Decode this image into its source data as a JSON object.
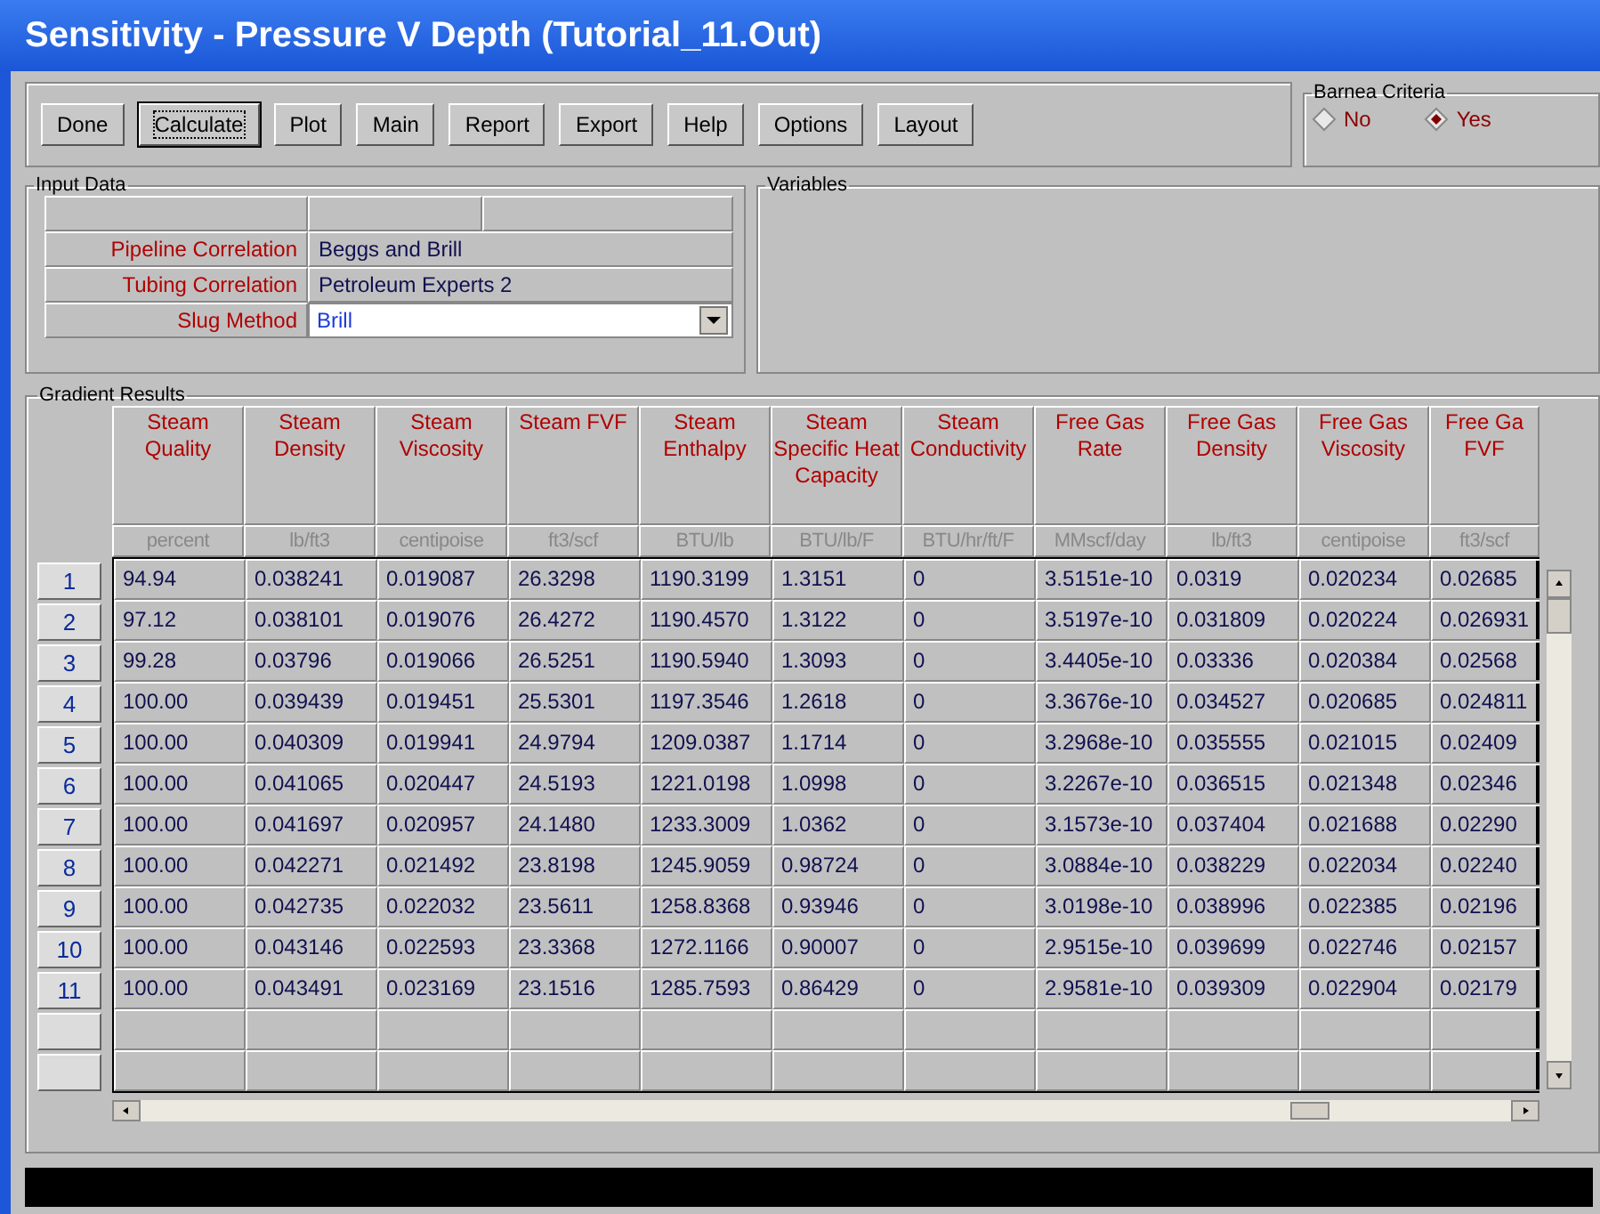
{
  "window": {
    "title": "Sensitivity - Pressure V Depth (Tutorial_11.Out)"
  },
  "toolbar": [
    {
      "label": "Done",
      "focused": false
    },
    {
      "label": "Calculate",
      "focused": true
    },
    {
      "label": "Plot",
      "focused": false
    },
    {
      "label": "Main",
      "focused": false
    },
    {
      "label": "Report",
      "focused": false
    },
    {
      "label": "Export",
      "focused": false
    },
    {
      "label": "Help",
      "focused": false
    },
    {
      "label": "Options",
      "focused": false
    },
    {
      "label": "Layout",
      "focused": false
    }
  ],
  "barnea_criteria": {
    "title": "Barnea Criteria",
    "options": [
      {
        "label": "No",
        "selected": false
      },
      {
        "label": "Yes",
        "selected": true
      }
    ]
  },
  "input_data": {
    "title": "Input Data",
    "rows": [
      {
        "label": "Pipeline Correlation",
        "value": "Beggs and Brill"
      },
      {
        "label": "Tubing Correlation",
        "value": "Petroleum Experts 2"
      }
    ],
    "slug_method": {
      "label": "Slug Method",
      "value": "Brill"
    }
  },
  "variables": {
    "title": "Variables"
  },
  "gradient_results": {
    "title": "Gradient Results",
    "columns": [
      {
        "name": "Steam Quality",
        "unit": "percent"
      },
      {
        "name": "Steam Density",
        "unit": "lb/ft3"
      },
      {
        "name": "Steam Viscosity",
        "unit": "centipoise"
      },
      {
        "name": "Steam FVF",
        "unit": "ft3/scf"
      },
      {
        "name": "Steam Enthalpy",
        "unit": "BTU/lb"
      },
      {
        "name": "Steam Specific Heat Capacity",
        "unit": "BTU/lb/F"
      },
      {
        "name": "Steam Conductivity",
        "unit": "BTU/hr/ft/F"
      },
      {
        "name": "Free Gas Rate",
        "unit": "MMscf/day"
      },
      {
        "name": "Free Gas Density",
        "unit": "lb/ft3"
      },
      {
        "name": "Free Gas Viscosity",
        "unit": "centipoise"
      },
      {
        "name": "Free Ga FVF",
        "unit": "ft3/scf"
      }
    ],
    "rows": [
      {
        "number": "1",
        "cells": [
          "94.94",
          "0.038241",
          "0.019087",
          "26.3298",
          "1190.3199",
          "1.3151",
          "0",
          "3.5151e-10",
          "0.0319",
          "0.020234",
          "0.02685"
        ]
      },
      {
        "number": "2",
        "cells": [
          "97.12",
          "0.038101",
          "0.019076",
          "26.4272",
          "1190.4570",
          "1.3122",
          "0",
          "3.5197e-10",
          "0.031809",
          "0.020224",
          "0.026931"
        ]
      },
      {
        "number": "3",
        "cells": [
          "99.28",
          "0.03796",
          "0.019066",
          "26.5251",
          "1190.5940",
          "1.3093",
          "0",
          "3.4405e-10",
          "0.03336",
          "0.020384",
          "0.02568"
        ]
      },
      {
        "number": "4",
        "cells": [
          "100.00",
          "0.039439",
          "0.019451",
          "25.5301",
          "1197.3546",
          "1.2618",
          "0",
          "3.3676e-10",
          "0.034527",
          "0.020685",
          "0.024811"
        ]
      },
      {
        "number": "5",
        "cells": [
          "100.00",
          "0.040309",
          "0.019941",
          "24.9794",
          "1209.0387",
          "1.1714",
          "0",
          "3.2968e-10",
          "0.035555",
          "0.021015",
          "0.02409"
        ]
      },
      {
        "number": "6",
        "cells": [
          "100.00",
          "0.041065",
          "0.020447",
          "24.5193",
          "1221.0198",
          "1.0998",
          "0",
          "3.2267e-10",
          "0.036515",
          "0.021348",
          "0.02346"
        ]
      },
      {
        "number": "7",
        "cells": [
          "100.00",
          "0.041697",
          "0.020957",
          "24.1480",
          "1233.3009",
          "1.0362",
          "0",
          "3.1573e-10",
          "0.037404",
          "0.021688",
          "0.02290"
        ]
      },
      {
        "number": "8",
        "cells": [
          "100.00",
          "0.042271",
          "0.021492",
          "23.8198",
          "1245.9059",
          "0.98724",
          "0",
          "3.0884e-10",
          "0.038229",
          "0.022034",
          "0.02240"
        ]
      },
      {
        "number": "9",
        "cells": [
          "100.00",
          "0.042735",
          "0.022032",
          "23.5611",
          "1258.8368",
          "0.93946",
          "0",
          "3.0198e-10",
          "0.038996",
          "0.022385",
          "0.02196"
        ]
      },
      {
        "number": "10",
        "cells": [
          "100.00",
          "0.043146",
          "0.022593",
          "23.3368",
          "1272.1166",
          "0.90007",
          "0",
          "2.9515e-10",
          "0.039699",
          "0.022746",
          "0.02157"
        ]
      },
      {
        "number": "11",
        "cells": [
          "100.00",
          "0.043491",
          "0.023169",
          "23.1516",
          "1285.7593",
          "0.86429",
          "0",
          "2.9581e-10",
          "0.039309",
          "0.022904",
          "0.02179"
        ]
      }
    ]
  }
}
